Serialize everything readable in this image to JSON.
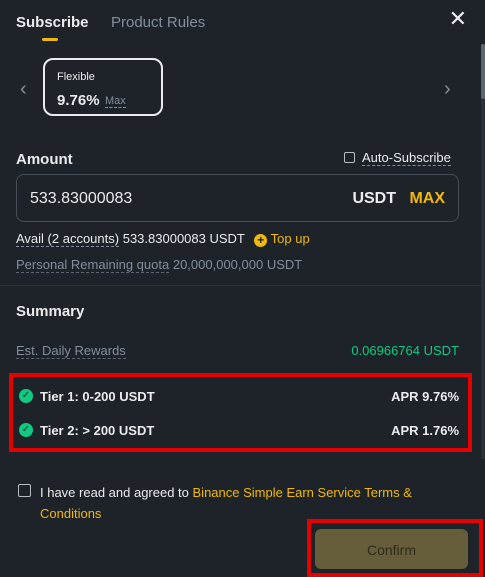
{
  "tabs": {
    "subscribe": "Subscribe",
    "product_rules": "Product Rules"
  },
  "icons": {
    "close": "close-icon",
    "prev": "chevron-left-icon",
    "next": "chevron-right-icon"
  },
  "product": {
    "name": "Flexible",
    "rate": "9.76%",
    "max_label": "Max"
  },
  "amount": {
    "label": "Amount",
    "auto_subscribe_label": "Auto-Subscribe",
    "auto_subscribe_checked": false,
    "value": "533.83000083",
    "unit": "USDT",
    "max_label": "MAX"
  },
  "avail": {
    "label": "Avail (2 accounts)",
    "value": "533.83000083 USDT",
    "topup_label": "Top up"
  },
  "quota": {
    "label": "Personal Remaining quota",
    "value": "20,000,000,000 USDT"
  },
  "summary": {
    "title": "Summary",
    "daily_rewards_label": "Est. Daily Rewards",
    "daily_rewards_value": "0.06966764 USDT",
    "tiers": [
      {
        "label": "Tier 1: 0-200 USDT",
        "apr": "APR 9.76%"
      },
      {
        "label": "Tier 2: > 200 USDT",
        "apr": "APR 1.76%"
      }
    ]
  },
  "agreement": {
    "checked": false,
    "prefix": "I have read and agreed to ",
    "link": "Binance Simple Earn Service Terms & Conditions"
  },
  "confirm_label": "Confirm",
  "colors": {
    "accent": "#f0b90b",
    "positive": "#0ecb81",
    "highlight": "#e60000",
    "background": "#1e2329"
  }
}
